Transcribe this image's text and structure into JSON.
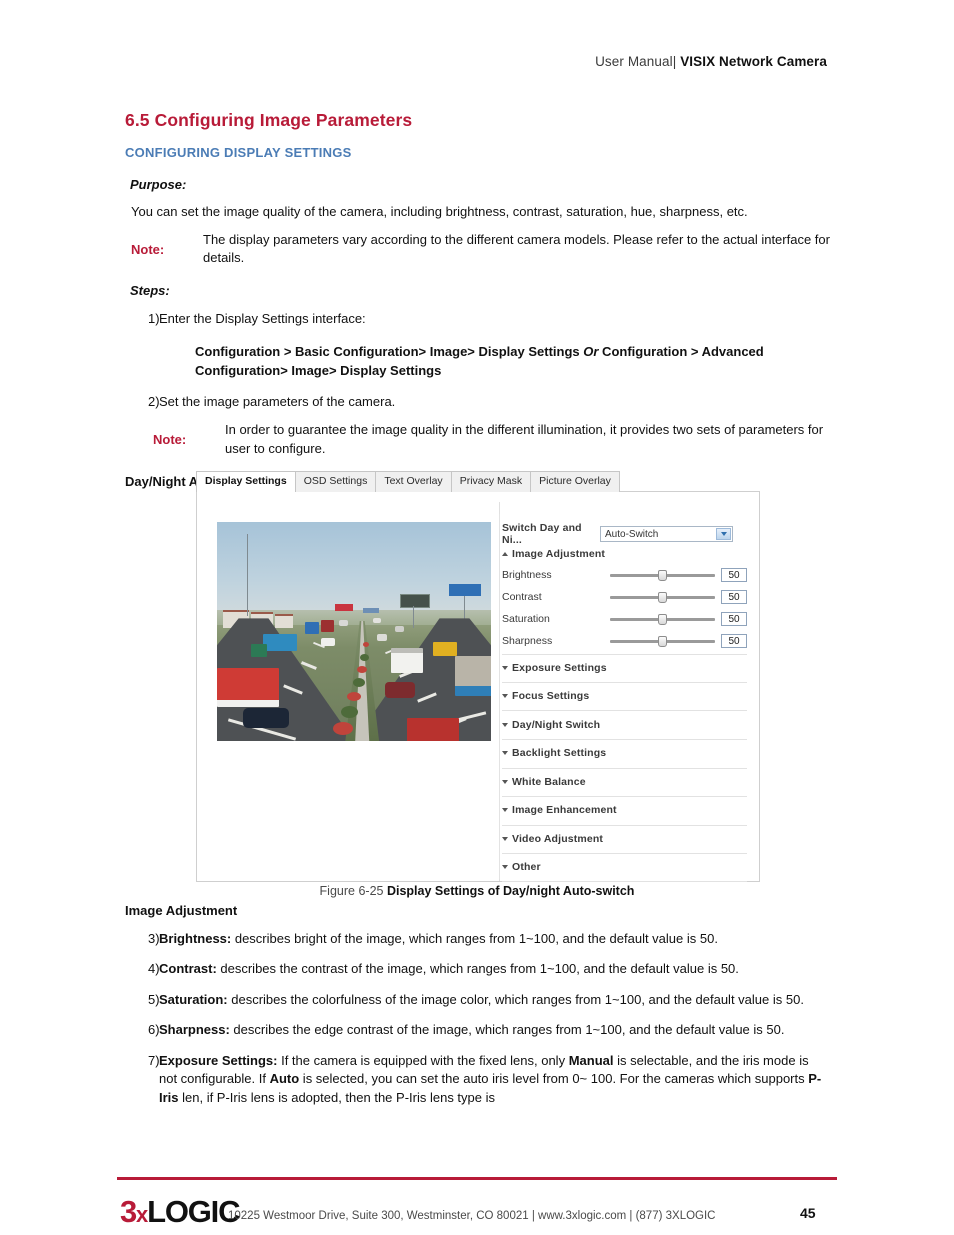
{
  "header": {
    "prefix": "User Manual|",
    "product": "VISIX Network Camera"
  },
  "section": {
    "number": "6.5",
    "title": "Configuring Image Parameters",
    "subtitle": "CONFIGURING DISPLAY SETTINGS",
    "purpose_label": "Purpose:",
    "purpose_text": "You can set the image quality of the camera, including brightness, contrast, saturation, hue, sharpness, etc.",
    "note_label": "Note:",
    "note_1": "The display parameters vary according to the different camera models. Please refer to the actual interface for details.",
    "steps_label": "Steps:",
    "step_1_marker": "1)",
    "step_1_text": "Enter the Display Settings interface:",
    "path_part_1": "Configuration > Basic Configuration> Image> Display Settings ",
    "path_or": "Or",
    "path_part_2": " Configuration > Advanced Configuration> Image> Display Settings",
    "step_2_marker": "2)",
    "step_2_text": "Set the image parameters of the camera.",
    "note_2": "In order to guarantee the image quality in the different illumination, it provides two sets of parameters for user to configure.",
    "daynight_heading": "Day/Night Auto-switch"
  },
  "camera_ui": {
    "tabs": [
      {
        "label": "Display Settings",
        "active": true
      },
      {
        "label": "OSD Settings",
        "active": false
      },
      {
        "label": "Text Overlay",
        "active": false
      },
      {
        "label": "Privacy Mask",
        "active": false
      },
      {
        "label": "Picture Overlay",
        "active": false
      }
    ],
    "switch_row": {
      "label": "Switch Day and Ni...",
      "value": "Auto-Switch"
    },
    "image_adjustment_heading": "Image Adjustment",
    "sliders": [
      {
        "label": "Brightness",
        "value": "50",
        "percent": 50
      },
      {
        "label": "Contrast",
        "value": "50",
        "percent": 50
      },
      {
        "label": "Saturation",
        "value": "50",
        "percent": 50
      },
      {
        "label": "Sharpness",
        "value": "50",
        "percent": 50
      }
    ],
    "collapsed_sections": [
      "Exposure Settings",
      "Focus Settings",
      "Day/Night Switch",
      "Backlight Settings",
      "White Balance",
      "Image Enhancement",
      "Video Adjustment",
      "Other"
    ]
  },
  "figure": {
    "number": "Figure 6-25",
    "caption": "Display Settings of Day/night Auto-switch"
  },
  "lower": {
    "image_adjustment_heading": "Image Adjustment",
    "items": [
      {
        "marker": "3)",
        "term": "Brightness:",
        "text": " describes bright of the image, which ranges from 1~100, and the default value is 50."
      },
      {
        "marker": "4)",
        "term": "Contrast:",
        "text": " describes the contrast of the image, which ranges from 1~100, and the default value is 50."
      },
      {
        "marker": "5)",
        "term": "Saturation:",
        "text": " describes the colorfulness of the image color, which ranges from 1~100, and the default value is 50."
      },
      {
        "marker": "6)",
        "term": "Sharpness:",
        "text": " describes the edge contrast of the image, which ranges from 1~100, and the default value is 50."
      }
    ],
    "item7": {
      "marker": "7)",
      "term": "Exposure Settings:",
      "t1": " If the camera is equipped with the fixed lens, only ",
      "b1": "Manual",
      "t2": " is selectable, and the iris mode is not configurable. If ",
      "b2": "Auto",
      "t3": " is selected, you can set the auto iris level from 0~ 100. For the cameras which supports ",
      "b3": "P-Iris",
      "t4": " len, if P-Iris lens is adopted, then the P-Iris lens type is"
    }
  },
  "footer": {
    "logo_3": "3",
    "logo_x": "x",
    "logo_logic": "LOGIC",
    "address": "10225 Westmoor Drive, Suite 300, Westminster, CO 80021 | www.3xlogic.com | (877) 3XLOGIC",
    "page_number": "45"
  },
  "colors": {
    "accent_red": "#b81b38",
    "accent_blue": "#4b7cb5"
  }
}
